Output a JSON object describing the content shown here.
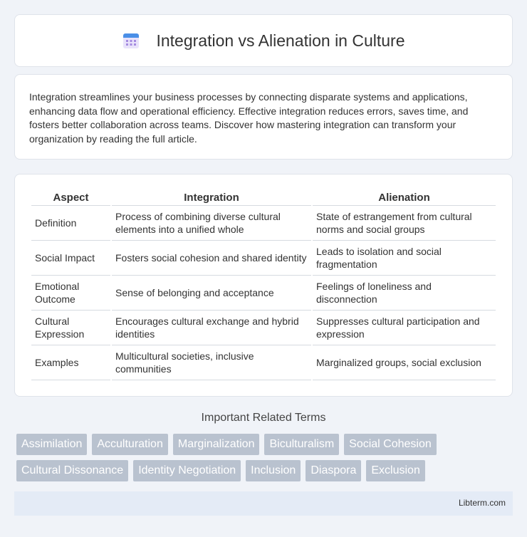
{
  "header": {
    "title": "Integration vs Alienation in Culture",
    "icon": "calendar-icon"
  },
  "intro": {
    "text": "Integration streamlines your business processes by connecting disparate systems and applications, enhancing data flow and operational efficiency. Effective integration reduces errors, saves time, and fosters better collaboration across teams. Discover how mastering integration can transform your organization by reading the full article."
  },
  "table": {
    "headers": [
      "Aspect",
      "Integration",
      "Alienation"
    ],
    "rows": [
      [
        "Definition",
        "Process of combining diverse cultural elements into a unified whole",
        "State of estrangement from cultural norms and social groups"
      ],
      [
        "Social Impact",
        "Fosters social cohesion and shared identity",
        "Leads to isolation and social fragmentation"
      ],
      [
        "Emotional Outcome",
        "Sense of belonging and acceptance",
        "Feelings of loneliness and disconnection"
      ],
      [
        "Cultural Expression",
        "Encourages cultural exchange and hybrid identities",
        "Suppresses cultural participation and expression"
      ],
      [
        "Examples",
        "Multicultural societies, inclusive communities",
        "Marginalized groups, social exclusion"
      ]
    ]
  },
  "related": {
    "title": "Important Related Terms",
    "tags": [
      "Assimilation",
      "Acculturation",
      "Marginalization",
      "Biculturalism",
      "Social Cohesion",
      "Cultural Dissonance",
      "Identity Negotiation",
      "Inclusion",
      "Diaspora",
      "Exclusion"
    ]
  },
  "footer": {
    "text": "Libterm.com"
  },
  "colors": {
    "tag_bg": "#b9c2cf",
    "icon_blue": "#4a8fe7",
    "icon_purple": "#a58be0"
  }
}
